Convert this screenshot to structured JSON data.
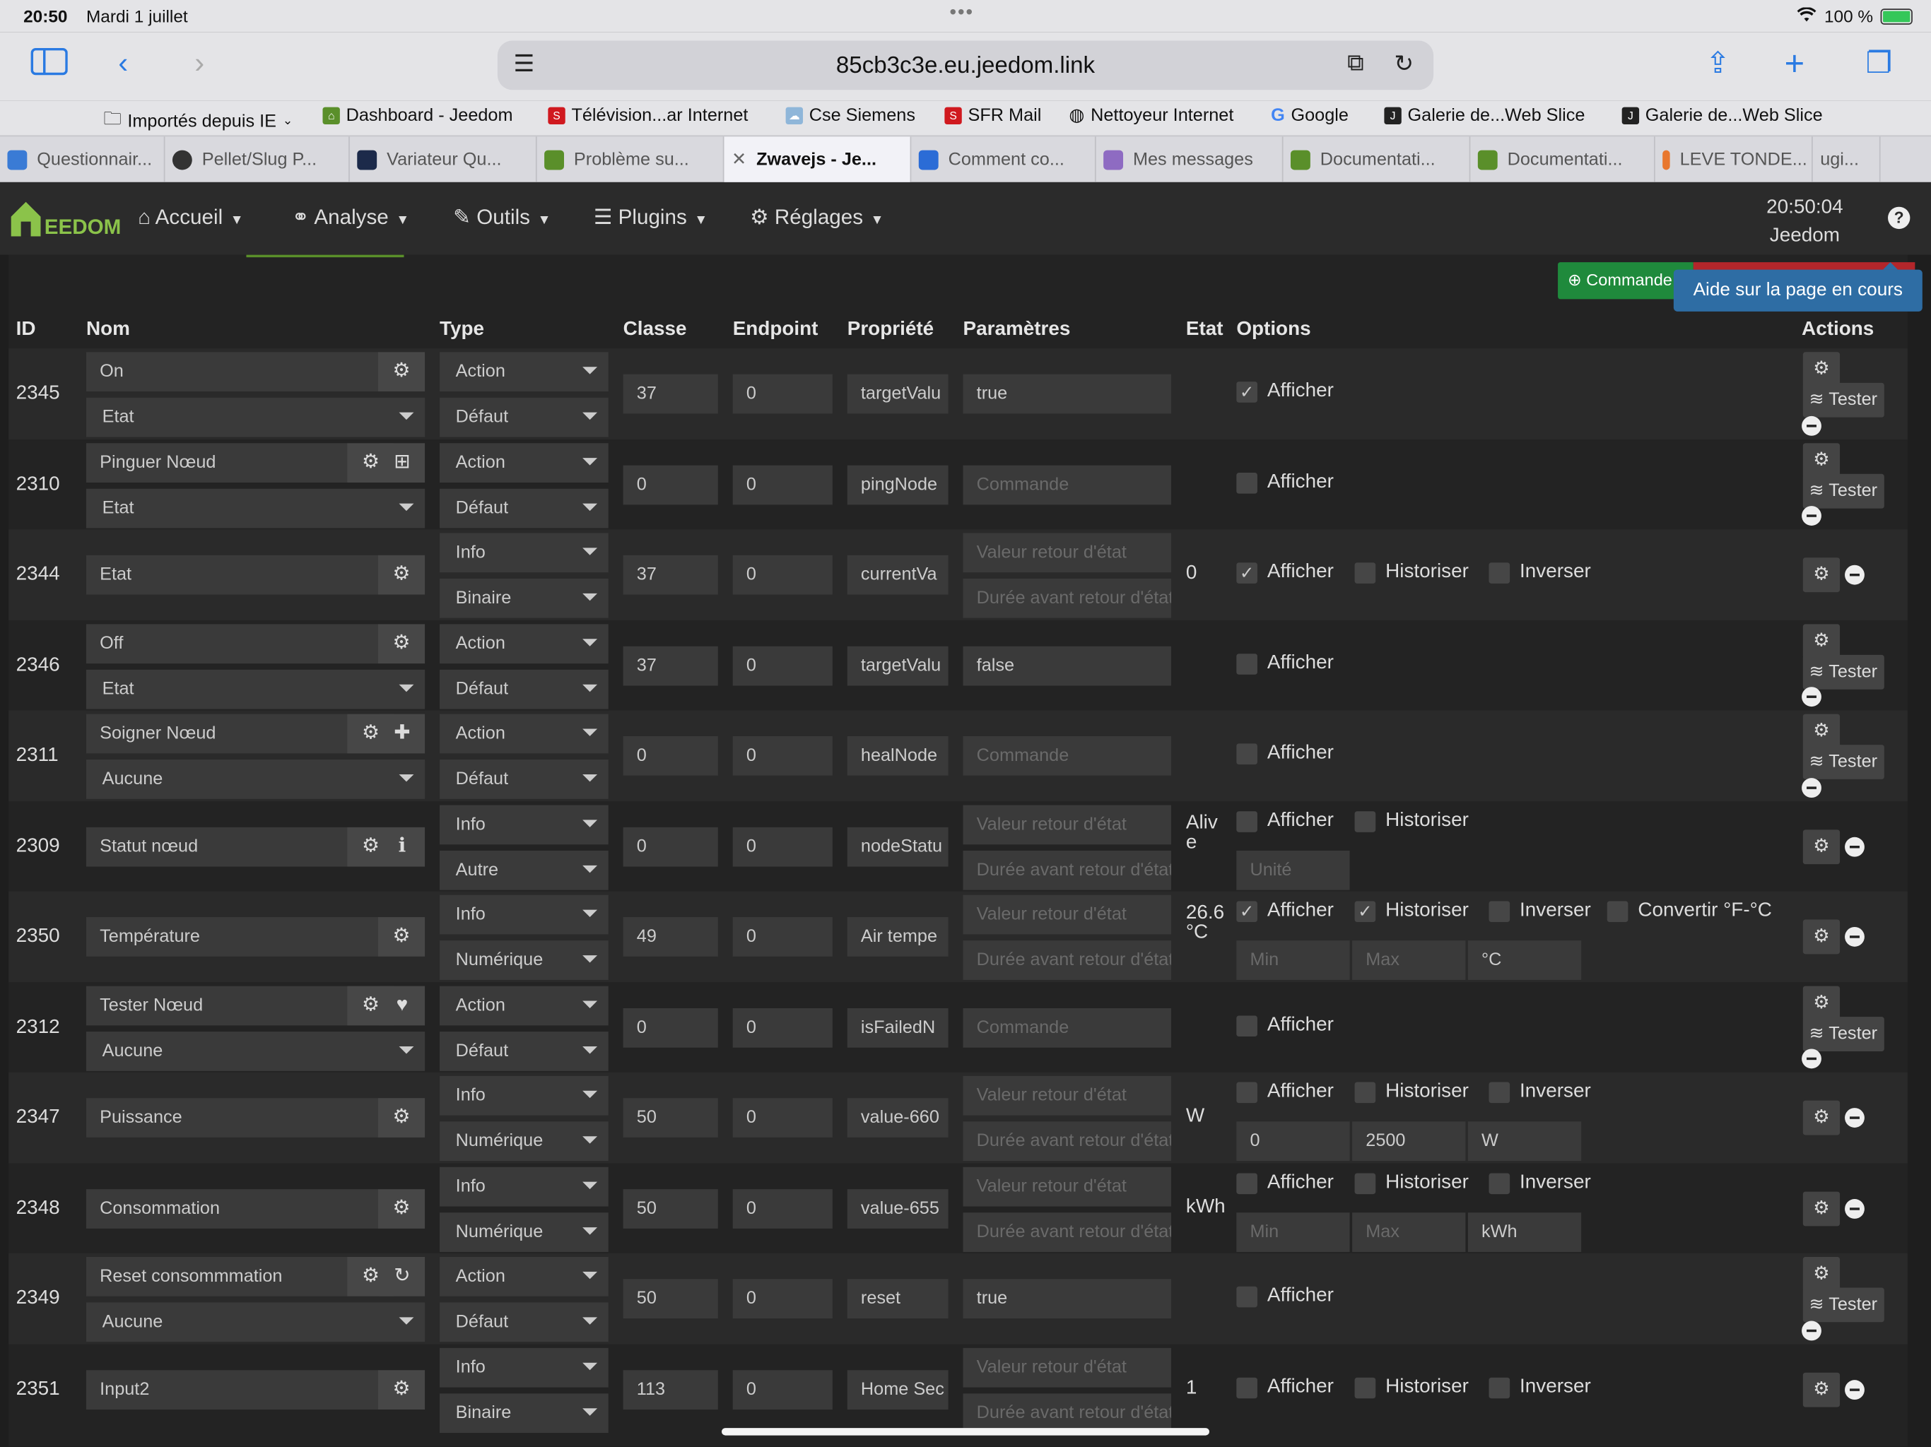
{
  "status": {
    "time": "20:50",
    "date": "Mardi 1 juillet",
    "battery": "100 %"
  },
  "browser": {
    "url": "85cb3c3e.eu.jeedom.link"
  },
  "bookmarks": [
    "Importés depuis IE",
    "Dashboard - Jeedom",
    "Télévision...ar Internet",
    "Cse Siemens",
    "SFR Mail",
    "Nettoyeur Internet",
    "Google",
    "Galerie de...Web Slice",
    "Galerie de...Web Slice"
  ],
  "tabs": [
    "Questionnair...",
    "Pellet/Slug P...",
    "Variateur Qu...",
    "Problème su...",
    "Zwavejs - Je...",
    "Comment co...",
    "Mes messages",
    "Documentati...",
    "Documentati...",
    "LEVE TONDE...",
    "ugi..."
  ],
  "nav": {
    "logo": "EEDOM",
    "menus": [
      "Accueil",
      "Analyse",
      "Outils",
      "Plugins",
      "Réglages"
    ],
    "clock_time": "20:50:04",
    "clock_label": "Jeedom"
  },
  "page": {
    "commands_button": "Commande",
    "tooltip": "Aide sur la page en cours"
  },
  "headers": {
    "id": "ID",
    "nom": "Nom",
    "type": "Type",
    "classe": "Classe",
    "endpoint": "Endpoint",
    "propriete": "Propriété",
    "parametres": "Paramètres",
    "etat": "Etat",
    "options": "Options",
    "actions": "Actions"
  },
  "labels": {
    "afficher": "Afficher",
    "historiser": "Historiser",
    "inverser": "Inverser",
    "convertir": "Convertir °F-°C",
    "tester": "Tester",
    "valeur_retour": "Valeur retour d'état",
    "duree_retour": "Durée avant retour d'état",
    "commande": "Commande",
    "unite": "Unité",
    "min": "Min",
    "max": "Max"
  },
  "rows": [
    {
      "id": "2345",
      "name": "On",
      "sub": "Etat",
      "type": "Action",
      "subtype": "Défaut",
      "classe": "37",
      "endpoint": "0",
      "prop": "targetValu",
      "param": "true",
      "afficher": true
    },
    {
      "id": "2310",
      "name": "Pinguer Nœud",
      "sub": "Etat",
      "type": "Action",
      "subtype": "Défaut",
      "classe": "0",
      "endpoint": "0",
      "prop": "pingNode",
      "param": "",
      "afficher": false
    },
    {
      "id": "2344",
      "name": "Etat",
      "type": "Info",
      "subtype": "Binaire",
      "classe": "37",
      "endpoint": "0",
      "prop": "currentVa",
      "etat": "0",
      "afficher": true,
      "historiser": false,
      "inverser": false
    },
    {
      "id": "2346",
      "name": "Off",
      "sub": "Etat",
      "type": "Action",
      "subtype": "Défaut",
      "classe": "37",
      "endpoint": "0",
      "prop": "targetValu",
      "param": "false",
      "afficher": false
    },
    {
      "id": "2311",
      "name": "Soigner Nœud",
      "sub": "Aucune",
      "type": "Action",
      "subtype": "Défaut",
      "classe": "0",
      "endpoint": "0",
      "prop": "healNode",
      "param": "",
      "afficher": false
    },
    {
      "id": "2309",
      "name": "Statut nœud",
      "type": "Info",
      "subtype": "Autre",
      "classe": "0",
      "endpoint": "0",
      "prop": "nodeStatu",
      "etat": "Alive",
      "afficher": false,
      "historiser": false
    },
    {
      "id": "2350",
      "name": "Température",
      "type": "Info",
      "subtype": "Numérique",
      "classe": "49",
      "endpoint": "0",
      "prop": "Air tempe",
      "etat": "26.6 °C",
      "afficher": true,
      "historiser": true,
      "inverser": false,
      "convertir": false,
      "min": "",
      "max": "",
      "unit": "°C"
    },
    {
      "id": "2312",
      "name": "Tester Nœud",
      "sub": "Aucune",
      "type": "Action",
      "subtype": "Défaut",
      "classe": "0",
      "endpoint": "0",
      "prop": "isFailedN",
      "param": "",
      "afficher": false
    },
    {
      "id": "2347",
      "name": "Puissance",
      "type": "Info",
      "subtype": "Numérique",
      "classe": "50",
      "endpoint": "0",
      "prop": "value-660",
      "etat": "W",
      "afficher": false,
      "historiser": false,
      "inverser": false,
      "min": "0",
      "max": "2500",
      "unit": "W"
    },
    {
      "id": "2348",
      "name": "Consommation",
      "type": "Info",
      "subtype": "Numérique",
      "classe": "50",
      "endpoint": "0",
      "prop": "value-655",
      "etat": "kWh",
      "afficher": false,
      "historiser": false,
      "inverser": false,
      "min": "",
      "max": "",
      "unit": "kWh"
    },
    {
      "id": "2349",
      "name": "Reset consommmation",
      "sub": "Aucune",
      "type": "Action",
      "subtype": "Défaut",
      "classe": "50",
      "endpoint": "0",
      "prop": "reset",
      "param": "true",
      "afficher": false
    },
    {
      "id": "2351",
      "name": "Input2",
      "type": "Info",
      "subtype": "Binaire",
      "classe": "113",
      "endpoint": "0",
      "prop": "Home Sec",
      "etat": "1",
      "afficher": false,
      "historiser": false,
      "inverser": false
    }
  ]
}
